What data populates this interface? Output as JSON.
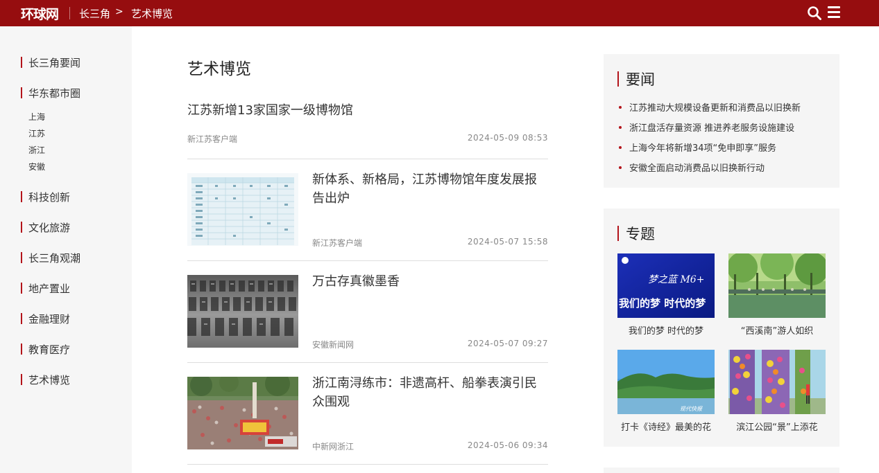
{
  "header": {
    "logo": "环球网",
    "breadcrumb": [
      "长三角",
      "艺术博览"
    ],
    "breadcrumb_sep": ">"
  },
  "leftnav": {
    "items": [
      {
        "label": "长三角要闻"
      },
      {
        "label": "华东都市圈",
        "children": [
          "上海",
          "江苏",
          "浙江",
          "安徽"
        ]
      },
      {
        "label": "科技创新"
      },
      {
        "label": "文化旅游"
      },
      {
        "label": "长三角观潮"
      },
      {
        "label": "地产置业"
      },
      {
        "label": "金融理财"
      },
      {
        "label": "教育医疗"
      },
      {
        "label": "艺术博览"
      }
    ]
  },
  "main": {
    "title": "艺术博览",
    "articles": [
      {
        "title": "江苏新增13家国家一级博物馆",
        "source": "新江苏客户端",
        "date": "2024-05-09 08:53"
      },
      {
        "title": "新体系、新格局，江苏博物馆年度发展报告出炉",
        "source": "新江苏客户端",
        "date": "2024-05-07 15:58"
      },
      {
        "title": "万古存真徽墨香",
        "source": "安徽新闻网",
        "date": "2024-05-07 09:27"
      },
      {
        "title": "浙江南浔练市：非遗高杆、船拳表演引民众围观",
        "source": "中新网浙江",
        "date": "2024-05-06 09:34"
      }
    ]
  },
  "sidebar": {
    "news": {
      "heading": "要闻",
      "items": [
        "江苏推动大规模设备更新和消费品以旧换新",
        "浙江盘活存量资源 推进养老服务设施建设",
        "上海今年将新增34项“免申即享”服务",
        "安徽全面启动消费品以旧换新行动"
      ]
    },
    "topics": {
      "heading": "专题",
      "items": [
        {
          "caption": "我们的梦 时代的梦",
          "image_text_1": "梦之蓝 M6+",
          "image_text_2": "我们的梦 时代的梦"
        },
        {
          "caption": "“西溪南”游人如织"
        },
        {
          "caption": "打卡《诗经》最美的花",
          "image_text_1": "现代快报"
        },
        {
          "caption": "滨江公园“景”上添花"
        }
      ]
    }
  },
  "colors": {
    "brand": "#960d0f",
    "accent": "#b3131a"
  }
}
